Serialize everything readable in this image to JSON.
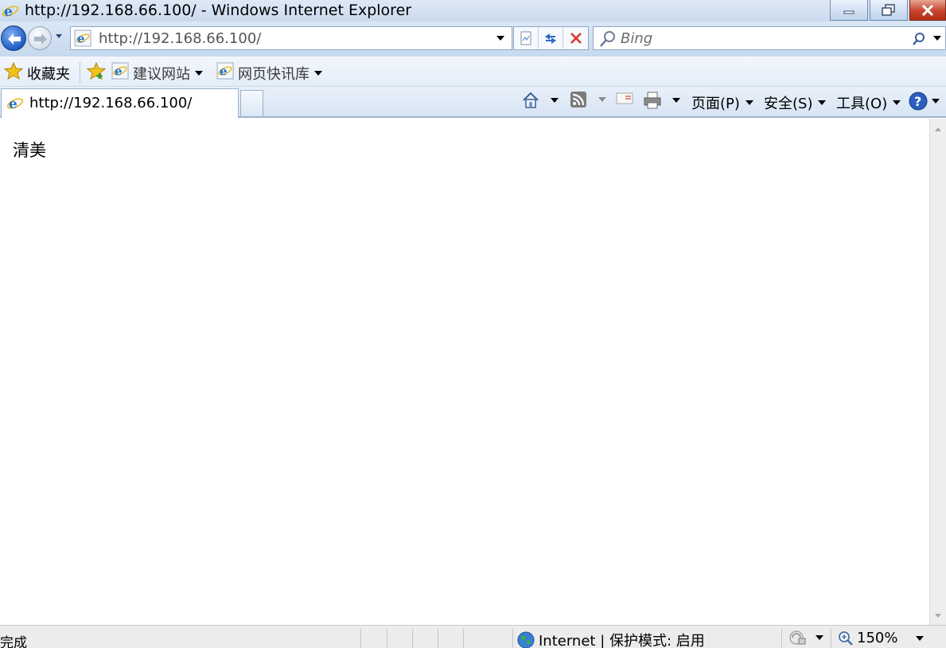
{
  "window": {
    "title": "http://192.168.66.100/ - Windows Internet Explorer",
    "controls": [
      "minimize",
      "restore",
      "close"
    ]
  },
  "navigation": {
    "address_url": "http://192.168.66.100/",
    "search_placeholder": "Bing",
    "icons": [
      "back-icon",
      "forward-icon",
      "compatibility-view-icon",
      "refresh-icon",
      "stop-icon",
      "search-icon"
    ]
  },
  "favorites_bar": {
    "favorites_label": "收藏夹",
    "items": [
      {
        "label": "建议网站"
      },
      {
        "label": "网页快讯库"
      }
    ]
  },
  "tabs": [
    {
      "label": "http://192.168.66.100/",
      "active": true
    }
  ],
  "command_bar": {
    "page_label": "页面(P)",
    "safety_label": "安全(S)",
    "tools_label": "工具(O)",
    "icons": [
      "home-icon",
      "rss-feed-icon",
      "read-mail-icon",
      "print-icon",
      "help-icon"
    ]
  },
  "content": {
    "text": "清美"
  },
  "status_bar": {
    "status_text": "完成",
    "zone_text": "Internet | 保护模式: 启用",
    "zoom_text": "150%"
  },
  "colors": {
    "chrome_blue": "#c9daee",
    "close_red": "#c6442d",
    "ie_blue": "#1f6fd1"
  }
}
